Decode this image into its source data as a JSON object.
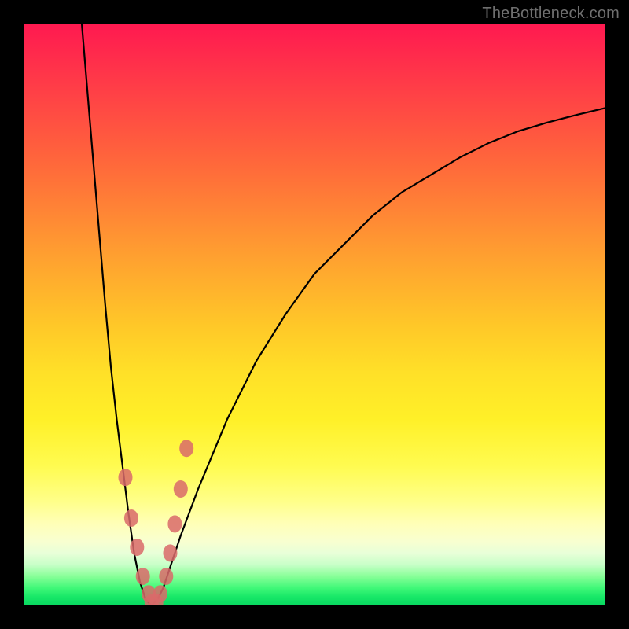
{
  "watermark": "TheBottleneck.com",
  "chart_data": {
    "type": "line",
    "title": "",
    "xlabel": "",
    "ylabel": "",
    "xlim": [
      0,
      100
    ],
    "ylim": [
      0,
      100
    ],
    "series": [
      {
        "name": "bottleneck-curve",
        "x": [
          10,
          11,
          12,
          13,
          14,
          15,
          16,
          17,
          18,
          19,
          20,
          21,
          22,
          23,
          24,
          25,
          27,
          30,
          35,
          40,
          45,
          50,
          55,
          60,
          65,
          70,
          75,
          80,
          85,
          90,
          95,
          100
        ],
        "y": [
          100,
          88,
          76,
          64,
          52,
          41,
          32,
          24,
          16,
          9,
          4,
          1,
          0,
          1,
          3,
          6,
          12,
          20,
          32,
          42,
          50,
          57,
          62,
          67,
          71,
          74,
          77,
          79.5,
          81.5,
          83,
          84.3,
          85.5
        ]
      }
    ],
    "markers": {
      "name": "data-points",
      "color": "#d96a6a",
      "x": [
        17.5,
        18.5,
        19.5,
        20.5,
        21.5,
        22.0,
        22.8,
        23.5,
        24.5,
        25.2,
        26.0,
        27.0,
        28.0
      ],
      "y": [
        22,
        15,
        10,
        5,
        2,
        0.5,
        0.5,
        2,
        5,
        9,
        14,
        20,
        27
      ]
    },
    "gradient_note": "vertical red→orange→yellow→green background; curve minimum (0) sits on green, higher returns toward red"
  }
}
